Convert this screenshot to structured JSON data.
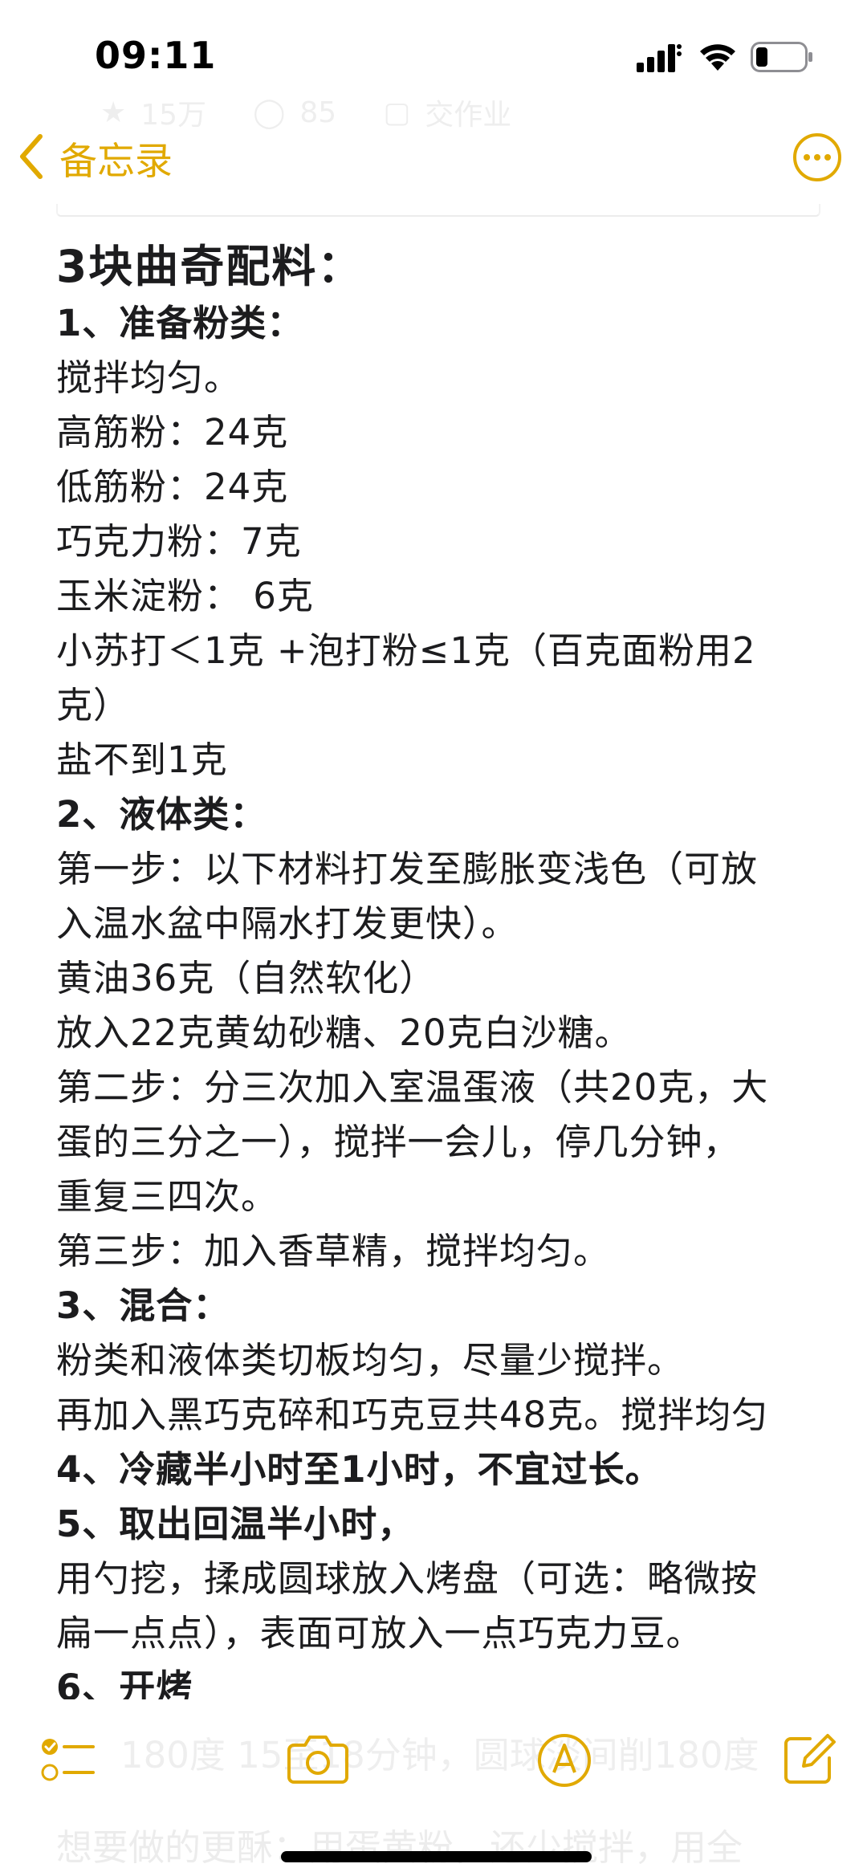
{
  "status_bar": {
    "time": "09:11"
  },
  "ghost_header": {
    "stars": "15万",
    "comments": "85",
    "photo": "交作业"
  },
  "nav": {
    "back_label": "备忘录"
  },
  "note": {
    "title": "3块曲奇配料：",
    "lines": [
      {
        "text": "1、准备粉类：",
        "bold": true
      },
      {
        "text": "搅拌均匀。",
        "bold": false
      },
      {
        "text": "高筋粉：24克",
        "bold": false
      },
      {
        "text": "低筋粉：24克",
        "bold": false
      },
      {
        "text": "巧克力粉：7克",
        "bold": false
      },
      {
        "text": "玉米淀粉： 6克",
        "bold": false
      },
      {
        "text": "小苏打＜1克 +泡打粉≤1克（百克面粉用2",
        "bold": false
      },
      {
        "text": "克）",
        "bold": false
      },
      {
        "text": "盐不到1克",
        "bold": false
      },
      {
        "text": "2、液体类：",
        "bold": true
      },
      {
        "text": "第一步：以下材料打发至膨胀变浅色（可放",
        "bold": false
      },
      {
        "text": "入温水盆中隔水打发更快）。",
        "bold": false
      },
      {
        "text": "黄油36克（自然软化）",
        "bold": false
      },
      {
        "text": "放入22克黄幼砂糖、20克白沙糖。",
        "bold": false
      },
      {
        "text": "第二步：分三次加入室温蛋液（共20克，大",
        "bold": false
      },
      {
        "text": "蛋的三分之一），搅拌一会儿，停几分钟，",
        "bold": false
      },
      {
        "text": "重复三四次。",
        "bold": false
      },
      {
        "text": "第三步：加入香草精，搅拌均匀。",
        "bold": false
      },
      {
        "text": "3、混合：",
        "bold": true
      },
      {
        "text": "粉类和液体类切板均匀，尽量少搅拌。",
        "bold": false
      },
      {
        "text": "再加入黑巧克碎和巧克豆共48克。搅拌均匀",
        "bold": false
      },
      {
        "text": "4、冷藏半小时至1小时，不宜过长。",
        "bold": true
      },
      {
        "text": "5、取出回温半小时，",
        "bold": true
      },
      {
        "text": "用勺挖，揉成圆球放入烤盘（可选：略微按",
        "bold": false
      },
      {
        "text": "扁一点点），表面可放入一点巧克力豆。",
        "bold": false
      },
      {
        "text": "6、开烤",
        "bold": true
      }
    ],
    "toolbar_ghost": "180度 15至18分钟，圆球淡间削180度",
    "bottom_ghost": "想要做的更酥：用蛋黄粉，还少搅拌，用全"
  },
  "colors": {
    "accent": "#e1a900",
    "text": "#1c1c1e",
    "background": "#ffffff"
  },
  "icons": {
    "checklist": "checklist-icon",
    "camera": "camera-icon",
    "markup": "markup-pen-icon",
    "compose": "compose-icon",
    "more": "ellipsis-circle-icon",
    "back": "chevron-left-icon"
  }
}
